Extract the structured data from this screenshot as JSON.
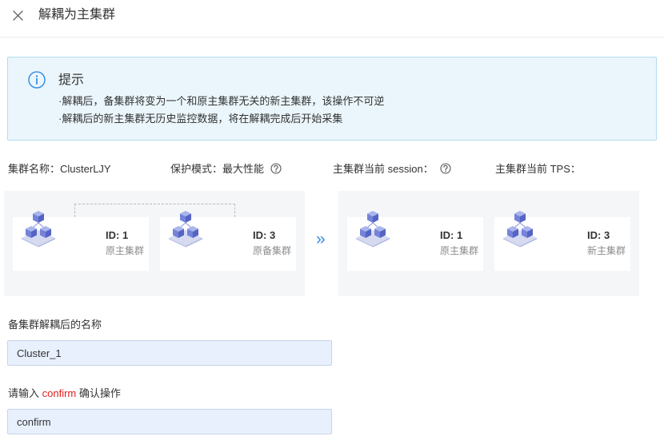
{
  "header": {
    "title": "解耦为主集群",
    "close_icon": "close-icon"
  },
  "notice": {
    "icon": "info-circle-icon",
    "title": "提示",
    "lines": [
      "·解耦后，备集群将变为一个和原主集群无关的新主集群，该操作不可逆",
      "·解耦后的新主集群无历史监控数据，将在解耦完成后开始采集"
    ]
  },
  "summary": {
    "cluster_name_label": "集群名称：",
    "cluster_name": "ClusterLJY",
    "protection_mode_label": "保护模式：",
    "protection_mode": "最大性能",
    "session_label": "主集群当前 session：",
    "tps_label": "主集群当前 TPS：",
    "help_icon": "question-circle-icon"
  },
  "topology": {
    "cluster_icon": "cluster-cubes-icon",
    "before": [
      {
        "id": "ID: 1",
        "role": "原主集群"
      },
      {
        "id": "ID: 3",
        "role": "原备集群"
      }
    ],
    "arrow": "»",
    "after": [
      {
        "id": "ID: 1",
        "role": "原主集群"
      },
      {
        "id": "ID: 3",
        "role": "新主集群"
      }
    ]
  },
  "form": {
    "name_label": "备集群解耦后的名称",
    "name_value": "Cluster_1",
    "confirm_label_prefix": "请输入 ",
    "confirm_keyword": "confirm",
    "confirm_label_suffix": " 确认操作",
    "confirm_value": "confirm"
  },
  "colors": {
    "accent": "#3a8ee6",
    "danger": "#e02020",
    "notice_bg": "#ebf6fc",
    "notice_border": "#b3dbf1",
    "panel_bg": "#f5f6f8",
    "input_bg": "#e8f0fe",
    "input_border": "#c8d3e8"
  }
}
